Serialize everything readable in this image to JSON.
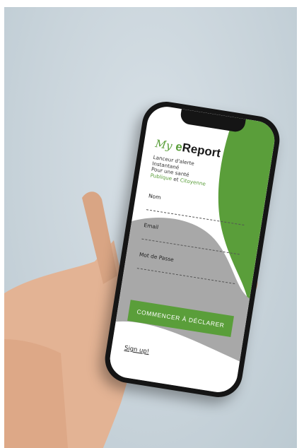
{
  "app": {
    "logo": {
      "prefix": "My",
      "accent": "e",
      "rest": "Report"
    },
    "tagline": {
      "line1": "Lanceur d'alerte",
      "line2": "Instantané",
      "line3": "Pour une santé",
      "publique": "Publique",
      "et": " et ",
      "citoyenne": "Citoyenne"
    },
    "form": {
      "name_label": "Nom",
      "email_label": "Email",
      "password_label": "Mot de Passe"
    },
    "cta_label": "COMMENCER À DÉCLARER",
    "signup_label": "Sign up!"
  },
  "colors": {
    "brand_green": "#5a9e3a",
    "panel_gray": "#a8a8a8",
    "phone_body": "#151515"
  },
  "icons": [
    "hand-photo",
    "phone-notch"
  ]
}
